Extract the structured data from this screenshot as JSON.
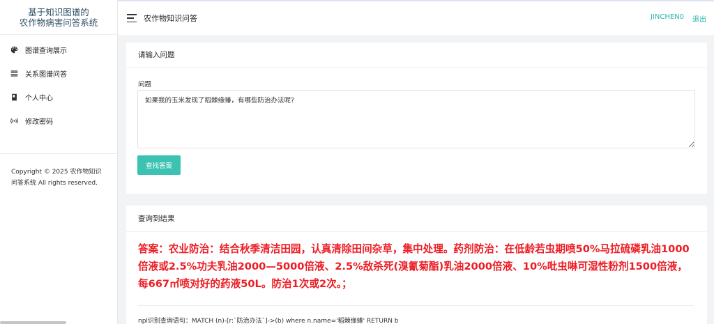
{
  "sidebar": {
    "brand_line1": "基于知识图谱的",
    "brand_line2": "农作物病害问答系统",
    "items": [
      {
        "label": "图谱查询展示",
        "icon": "palette-icon"
      },
      {
        "label": "关系图谱问答",
        "icon": "list-icon"
      },
      {
        "label": "个人中心",
        "icon": "book-icon"
      },
      {
        "label": "修改密码",
        "icon": "broadcast-icon"
      }
    ],
    "copyright": "Copyright © 2025 农作物知识问答系统 All rights reserved."
  },
  "header": {
    "title": "农作物知识问答",
    "username": "JINCHEN0",
    "logout": "退出"
  },
  "question_card": {
    "title": "请输入问题",
    "field_label": "问题",
    "question_value": "如果我的玉米发现了稻棘缘蝽，有哪些防治办法呢?",
    "submit_label": "查找答案"
  },
  "result_card": {
    "title": "查询到结果",
    "answer": "答案：农业防治：结合秋季清洁田园，认真清除田间杂草，集中处理。药剂防治：在低龄若虫期喷50%马拉硫磷乳油1000倍液或2.5%功夫乳油2000—5000倍液、2.5%敌杀死(溴氰菊酯)乳油2000倍液、10%吡虫啉可湿性粉剂1500倍液，每667㎡喷对好的药液50L。防治1次或2次。；",
    "query": "npl识别查询语句：MATCH (n)-[r:`防治办法`]->(b) where n.name='稻棘缘蝽' RETURN b"
  },
  "colors": {
    "accent": "#3cc2b2",
    "answer_red": "#ed1c24",
    "header_link": "#25b8ad"
  }
}
